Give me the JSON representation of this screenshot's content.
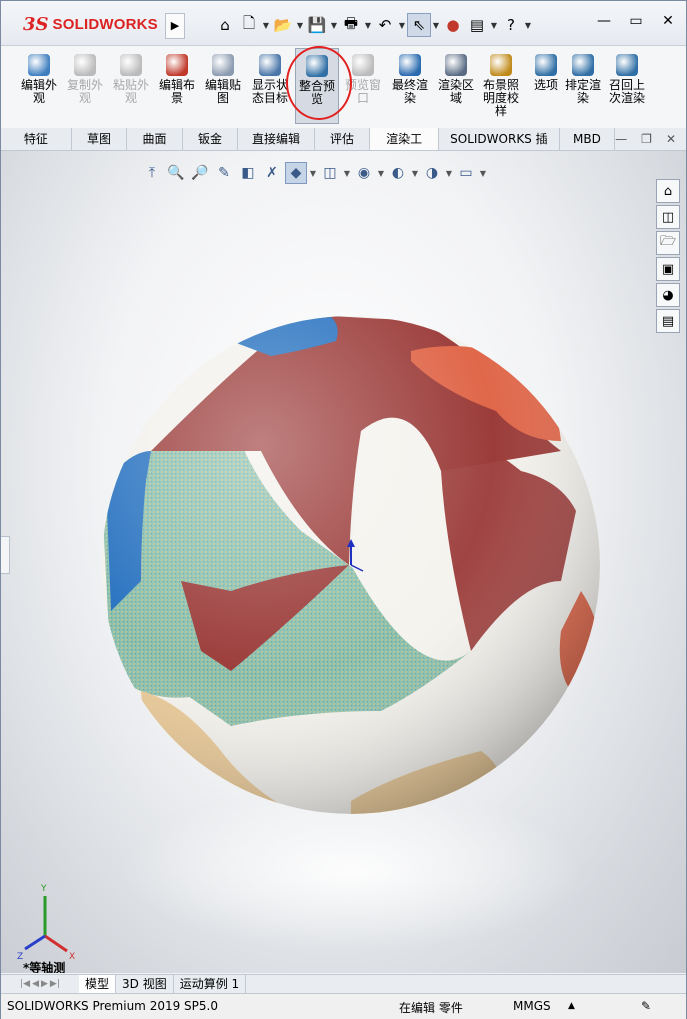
{
  "app": {
    "logo_mark": "3S",
    "logo_text": "SOLIDWORKS",
    "expand_glyph": "▶"
  },
  "titlebar": {
    "icons": [
      {
        "name": "home-icon",
        "glyph": "⌂"
      },
      {
        "name": "new-document-icon",
        "glyph": "🗋"
      },
      {
        "name": "open-folder-icon",
        "glyph": "📂"
      },
      {
        "name": "save-icon",
        "glyph": "💾"
      },
      {
        "name": "print-icon",
        "glyph": "🖶"
      },
      {
        "name": "undo-icon",
        "glyph": "↶"
      },
      {
        "name": "select-pointer-icon",
        "glyph": "⇖"
      },
      {
        "name": "rebuild-traffic-light-icon",
        "glyph": "●"
      },
      {
        "name": "file-properties-icon",
        "glyph": "▤"
      },
      {
        "name": "help-icon",
        "glyph": "?"
      }
    ],
    "window_controls": {
      "minimize": "—",
      "restore": "▭",
      "close": "✕"
    }
  },
  "ribbon": {
    "buttons": [
      {
        "name": "edit-appearance-button",
        "label": "编辑外观",
        "color": "#3f7fbf",
        "disabled": false
      },
      {
        "name": "copy-appearance-button",
        "label": "复制外观",
        "color": "#bbbbbb",
        "disabled": true
      },
      {
        "name": "paste-appearance-button",
        "label": "粘贴外观",
        "color": "#bbbbbb",
        "disabled": true
      },
      {
        "name": "edit-scene-button",
        "label": "编辑布景",
        "color": "#c0392b",
        "disabled": false
      },
      {
        "name": "edit-decal-button",
        "label": "编辑贴图",
        "color": "#8b9bb0",
        "disabled": false
      },
      {
        "name": "display-state-target-button",
        "label": "显示状态目标",
        "color": "#4a76a8",
        "disabled": false
      },
      {
        "name": "integrated-preview-button",
        "label": "整合预览",
        "color": "#2f6fa5",
        "disabled": false,
        "active": true
      },
      {
        "name": "preview-window-button",
        "label": "预览窗口",
        "color": "#bbbbbb",
        "disabled": true
      },
      {
        "name": "final-render-button",
        "label": "最终渲染",
        "color": "#2a6bb0",
        "disabled": false
      },
      {
        "name": "render-region-button",
        "label": "渲染区域",
        "color": "#5a6c84",
        "disabled": false
      },
      {
        "name": "scene-illumination-proofing-button",
        "label": "布景照明度校样",
        "color": "#c08a1a",
        "disabled": false
      },
      {
        "name": "options-button",
        "label": "选项",
        "color": "#2f6fa5",
        "disabled": false
      },
      {
        "name": "schedule-render-button",
        "label": "排定渲染",
        "color": "#2f6fa5",
        "disabled": false
      },
      {
        "name": "recall-last-render-button",
        "label": "召回上次渲染",
        "color": "#2f6fa5",
        "disabled": false
      }
    ]
  },
  "tabs": {
    "items": [
      {
        "label": "特征",
        "active": false
      },
      {
        "label": "草图",
        "active": false
      },
      {
        "label": "曲面",
        "active": false
      },
      {
        "label": "钣金",
        "active": false
      },
      {
        "label": "直接编辑",
        "active": false
      },
      {
        "label": "评估",
        "active": false
      },
      {
        "label": "渲染工具",
        "active": true
      },
      {
        "label": "SOLIDWORKS 插件",
        "active": false
      },
      {
        "label": "MBD",
        "active": false
      }
    ],
    "controls": {
      "minimize": "—",
      "restore": "❐",
      "close": "✕"
    }
  },
  "heads_up_toolbar": {
    "icons": [
      {
        "name": "normal-to-icon",
        "glyph": "⤒"
      },
      {
        "name": "zoom-to-fit-icon",
        "glyph": "🔍"
      },
      {
        "name": "zoom-to-area-icon",
        "glyph": "🔎"
      },
      {
        "name": "previous-view-icon",
        "glyph": "✎"
      },
      {
        "name": "section-view-icon",
        "glyph": "◧"
      },
      {
        "name": "dynamic-annotation-icon",
        "glyph": "✗"
      },
      {
        "name": "view-orientation-icon",
        "glyph": "◆"
      },
      {
        "name": "display-style-icon",
        "glyph": "◫"
      },
      {
        "name": "hide-show-items-icon",
        "glyph": "◉"
      },
      {
        "name": "edit-appearance-icon",
        "glyph": "◐"
      },
      {
        "name": "apply-scene-icon",
        "glyph": "◑"
      },
      {
        "name": "view-settings-icon",
        "glyph": "▭"
      }
    ]
  },
  "task_pane": {
    "icons": [
      {
        "name": "solidworks-resources-icon",
        "glyph": "⌂"
      },
      {
        "name": "design-library-icon",
        "glyph": "◫"
      },
      {
        "name": "file-explorer-icon",
        "glyph": "🗁"
      },
      {
        "name": "view-palette-icon",
        "glyph": "▣"
      },
      {
        "name": "appearances-scenes-icon",
        "glyph": "◕"
      },
      {
        "name": "custom-properties-icon",
        "glyph": "▤"
      }
    ]
  },
  "viewport": {
    "view_name": "*等轴测",
    "triad_labels": {
      "x": "X",
      "y": "Y",
      "z": "Z"
    },
    "colors": {
      "maroon": "#9b3c3a",
      "orange": "#e0674a",
      "blue": "#2872c0",
      "white": "#f3f1ec",
      "teal": "#8cc3b5",
      "sand": "#e8c896"
    }
  },
  "bottom_tabs": {
    "items": [
      {
        "label": "模型",
        "active": true
      },
      {
        "label": "3D 视图",
        "active": false
      },
      {
        "label": "运动算例 1",
        "active": false
      }
    ]
  },
  "statusbar": {
    "product": "SOLIDWORKS Premium 2019 SP5.0",
    "mode": "在编辑 零件",
    "units": "MMGS",
    "units_arrow": "▲"
  }
}
